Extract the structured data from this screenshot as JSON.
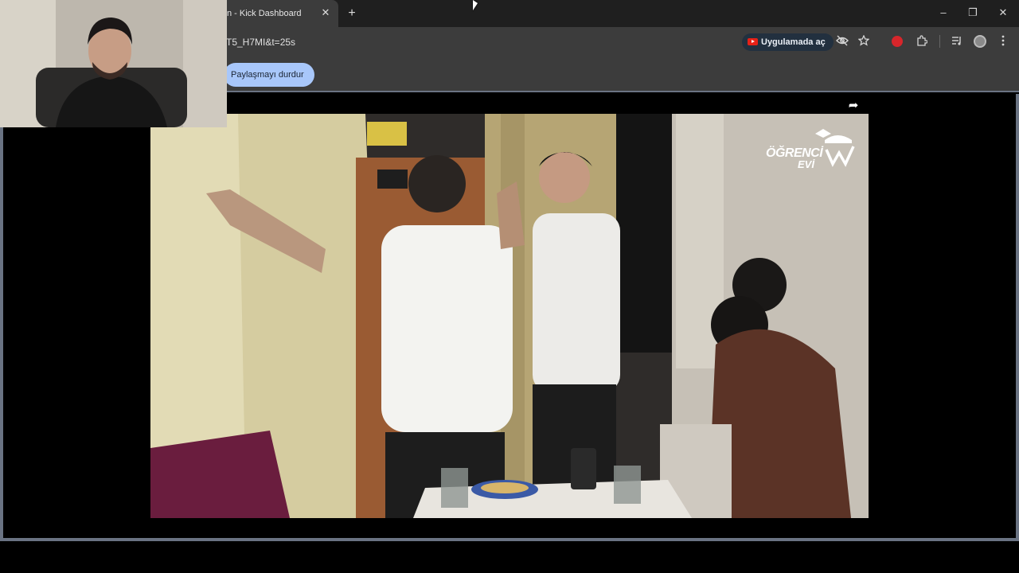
{
  "browser": {
    "tab_title": "n - Kick Dashboard",
    "tab_close": "✕",
    "new_tab": "+",
    "url_fragment": "T5_H7MI&t=25s",
    "open_in_app": "Uygulamada aç",
    "window_controls": {
      "minimize": "–",
      "restore": "❐",
      "close": "✕"
    },
    "toolbar_icons": [
      "eye-off-icon",
      "star-icon",
      "extension-record-icon",
      "puzzle-icon",
      "media-icon",
      "profile-avatar",
      "more-icon"
    ]
  },
  "infobar": {
    "stop_sharing": "Paylaşmayı durdur"
  },
  "video": {
    "share_glyph": "➦",
    "brand_line1": "ÖĞRENCİ",
    "brand_line2": "EVİ"
  },
  "colors": {
    "chrome_dark": "#1f1f1f",
    "chrome": "#3c3c3c",
    "share_pill": "#a8c7fa",
    "page_border": "#6a7383",
    "youtube_red": "#e62117"
  }
}
